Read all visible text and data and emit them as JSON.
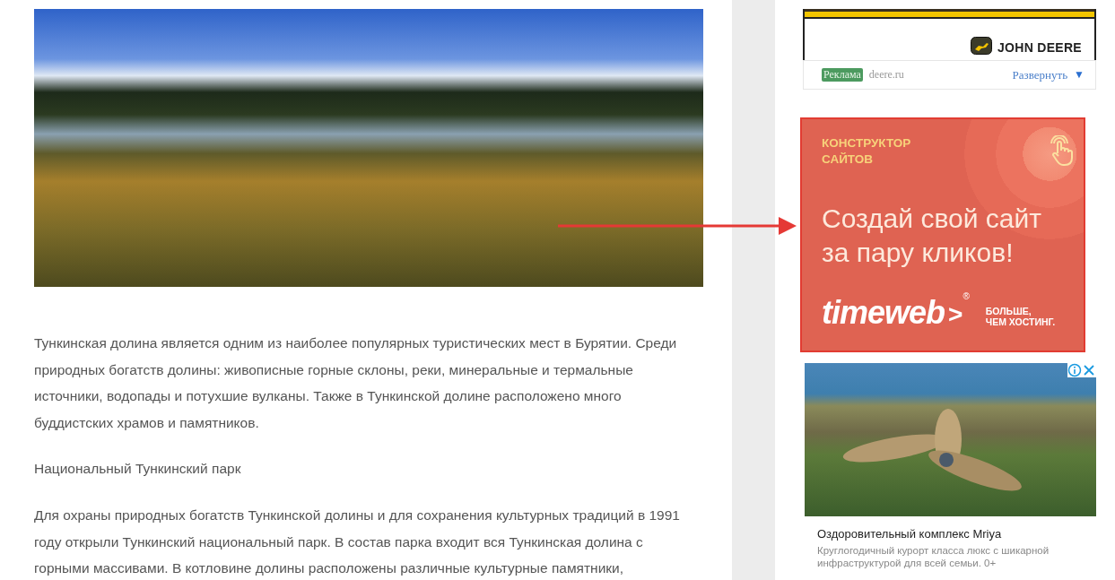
{
  "article": {
    "paragraphs": [
      "Тункинская долина является одним из наиболее популярных туристических мест в Бурятии. Среди природных богатств долины: живописные горные склоны, реки, минеральные и термальные источники, водопады и потухшие вулканы. Также в Тункинской долине расположено много буддистских храмов и памятников.",
      "Национальный Тункинский парк",
      "Для охраны природных богатств Тункинской долины и для сохранения культурных традиций в 1991 году открыли Тункинский национальный парк. В состав парка входит вся Тункинская долина с горными массивами. В котловине долины расположены различные культурные памятники,"
    ]
  },
  "sidebar": {
    "deere_ad": {
      "brand": "JOHN DEERE",
      "label": "Реклама",
      "domain": "deere.ru",
      "expand": "Развернуть",
      "expand_icon": "▼"
    },
    "timeweb_ad": {
      "eyebrow_lines": [
        "КОНСТРУКТОР",
        "САЙТОВ"
      ],
      "headline_lines": [
        "Создай свой сайт",
        "за пару кликов!"
      ],
      "logo": "timeweb",
      "logo_mark": ">",
      "registered": "®",
      "tagline_lines": [
        "БОЛЬШЕ,",
        "ЧЕМ ХОСТИНГ."
      ]
    },
    "native_ad": {
      "title": "Оздоровительный комплекс Mriya",
      "description": "Круглогодичный курорт класса люкс с шикарной инфраструктурой для всей семьи. 0+"
    }
  }
}
